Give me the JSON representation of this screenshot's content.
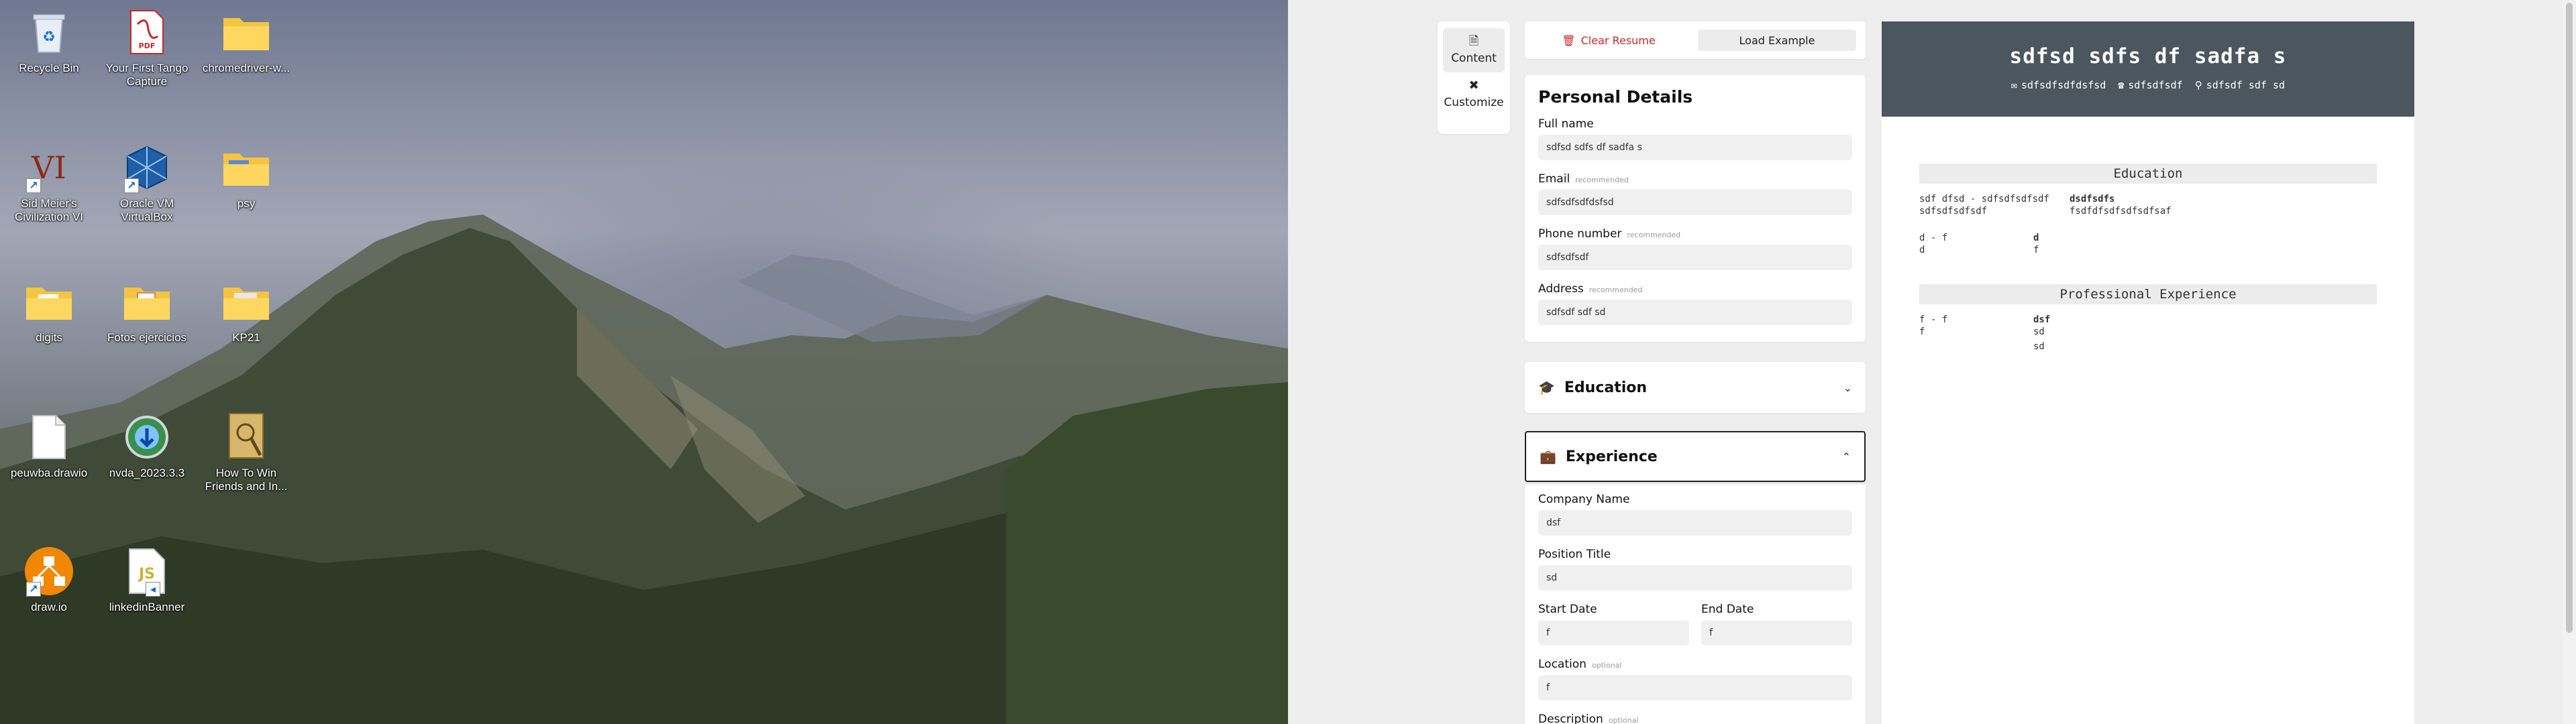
{
  "desktop": {
    "icons": [
      {
        "label": "Recycle Bin",
        "icon": "recycle-bin-icon"
      },
      {
        "label": "Your First Tango Capture",
        "icon": "pdf-icon"
      },
      {
        "label": "chromedriver-w...",
        "icon": "folder-icon"
      },
      {
        "label": "Sid Meier's Civilization VI",
        "icon": "civilization-icon"
      },
      {
        "label": "Oracle VM VirtualBox",
        "icon": "virtualbox-icon"
      },
      {
        "label": "psy",
        "icon": "folder-icon"
      },
      {
        "label": "digits",
        "icon": "folder-icon"
      },
      {
        "label": "Fotos ejercicios",
        "icon": "folder-icon"
      },
      {
        "label": "KP21",
        "icon": "folder-icon"
      },
      {
        "label": "peuwba.drawio",
        "icon": "file-icon"
      },
      {
        "label": "nvda_2023.3.3",
        "icon": "nvda-installer-icon"
      },
      {
        "label": "How To Win Friends and In...",
        "icon": "book-icon"
      },
      {
        "label": "draw.io",
        "icon": "drawio-icon"
      },
      {
        "label": "linkedinBanner",
        "icon": "js-file-icon"
      }
    ]
  },
  "side_tabs": [
    {
      "label": "Content",
      "icon": "document-icon",
      "active": true
    },
    {
      "label": "Customize",
      "icon": "tools-icon",
      "active": false
    }
  ],
  "actions": {
    "clear": "Clear Resume",
    "load": "Load Example"
  },
  "personal": {
    "title": "Personal Details",
    "fields": [
      {
        "label": "Full name",
        "hint": "",
        "value": "sdfsd sdfs df sadfa s"
      },
      {
        "label": "Email",
        "hint": "recommended",
        "value": "sdfsdfsdfdsfsd"
      },
      {
        "label": "Phone number",
        "hint": "recommended",
        "value": "sdfsdfsdf"
      },
      {
        "label": "Address",
        "hint": "recommended",
        "value": "sdfsdf sdf sd"
      }
    ]
  },
  "education": {
    "title": "Education"
  },
  "experience": {
    "title": "Experience",
    "company": {
      "label": "Company Name",
      "value": "dsf"
    },
    "position": {
      "label": "Position Title",
      "value": "sd"
    },
    "start": {
      "label": "Start Date",
      "value": "f"
    },
    "end": {
      "label": "End Date",
      "value": "f"
    },
    "location": {
      "label": "Location",
      "hint": "optional",
      "value": "f"
    },
    "description": {
      "label": "Description",
      "hint": "optional"
    }
  },
  "resume": {
    "name": "sdfsd sdfs df sadfa s",
    "email": "sdfsdfsdfdsfsd",
    "phone": "sdfsdfsdf",
    "address": "sdfsdf sdf sd",
    "education_title": "Education",
    "education": [
      {
        "dates": "sdf dfsd - sdfsdfsdfsdf",
        "place": "sdfsdfsdfsdf",
        "title": "dsdfsdfs",
        "detail": "fsdfdfsdfsdfsdfsaf"
      },
      {
        "dates": "d - f",
        "place": "d",
        "title": "d",
        "detail": "f"
      }
    ],
    "experience_title": "Professional Experience",
    "experience": [
      {
        "dates": "f - f",
        "place": "f",
        "title": "dsf",
        "detail": "sd",
        "extra": "sd"
      }
    ]
  },
  "colors": {
    "header": "#4b565e",
    "clear_red": "#c62828",
    "accent_border": "#222222"
  }
}
